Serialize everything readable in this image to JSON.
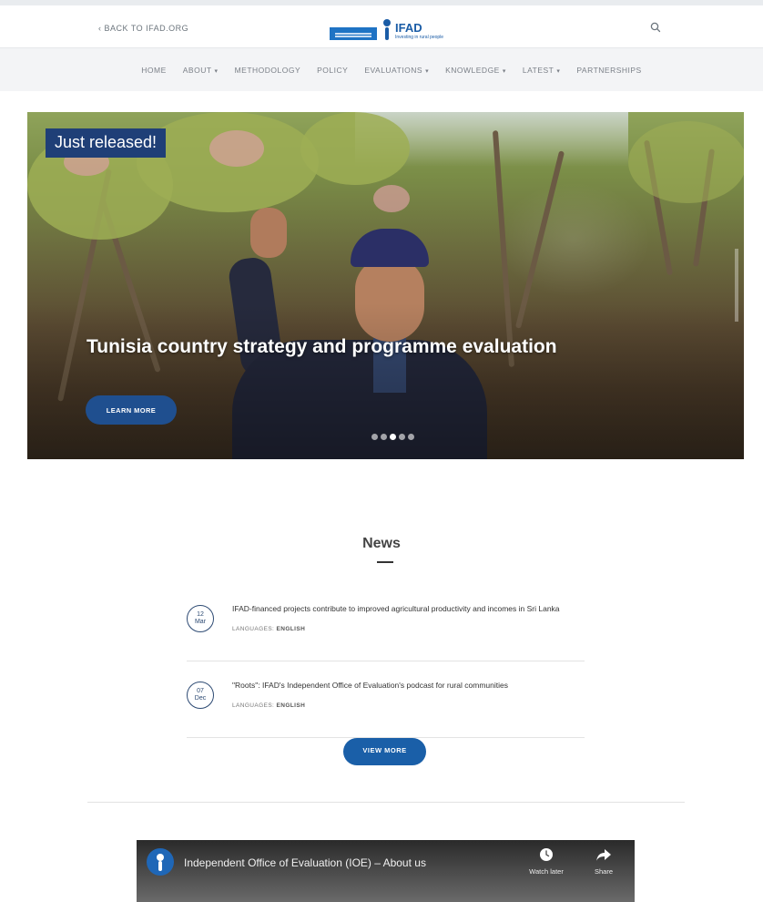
{
  "header": {
    "back_link": "‹ BACK TO IFAD.ORG",
    "logo": {
      "name": "IFAD",
      "tagline": "Investing in rural people",
      "icon": "ifad-logo"
    },
    "search_icon": "search-icon"
  },
  "nav": {
    "items": [
      {
        "label": "HOME",
        "has_dropdown": false
      },
      {
        "label": "ABOUT",
        "has_dropdown": true
      },
      {
        "label": "METHODOLOGY",
        "has_dropdown": false
      },
      {
        "label": "POLICY",
        "has_dropdown": false
      },
      {
        "label": "EVALUATIONS",
        "has_dropdown": true
      },
      {
        "label": "KNOWLEDGE",
        "has_dropdown": true
      },
      {
        "label": "LATEST",
        "has_dropdown": true
      },
      {
        "label": "PARTNERSHIPS",
        "has_dropdown": false
      }
    ],
    "caret": "▾"
  },
  "hero": {
    "badge": "Just released!",
    "title": "Tunisia country strategy and programme evaluation",
    "button": "LEARN MORE",
    "slides": 5,
    "active_slide": 3
  },
  "news": {
    "heading": "News",
    "items": [
      {
        "day": "12",
        "month": "Mar",
        "title": "IFAD-financed projects contribute to improved agricultural productivity and incomes in Sri Lanka",
        "lang_label": "LANGUAGES:",
        "lang_value": "ENGLISH"
      },
      {
        "day": "07",
        "month": "Dec",
        "title": "\"Roots\": IFAD's Independent Office of Evaluation's podcast for rural communities",
        "lang_label": "LANGUAGES:",
        "lang_value": "ENGLISH"
      }
    ],
    "view_more": "VIEW MORE"
  },
  "video": {
    "title": "Independent Office of Evaluation (IOE) – About us",
    "watch_later": "Watch later",
    "share": "Share"
  },
  "colors": {
    "brand_blue": "#1a5ca6",
    "badge_navy": "#1f3f77",
    "button_blue": "#1a5fa8",
    "nav_bg": "#f3f4f6"
  }
}
